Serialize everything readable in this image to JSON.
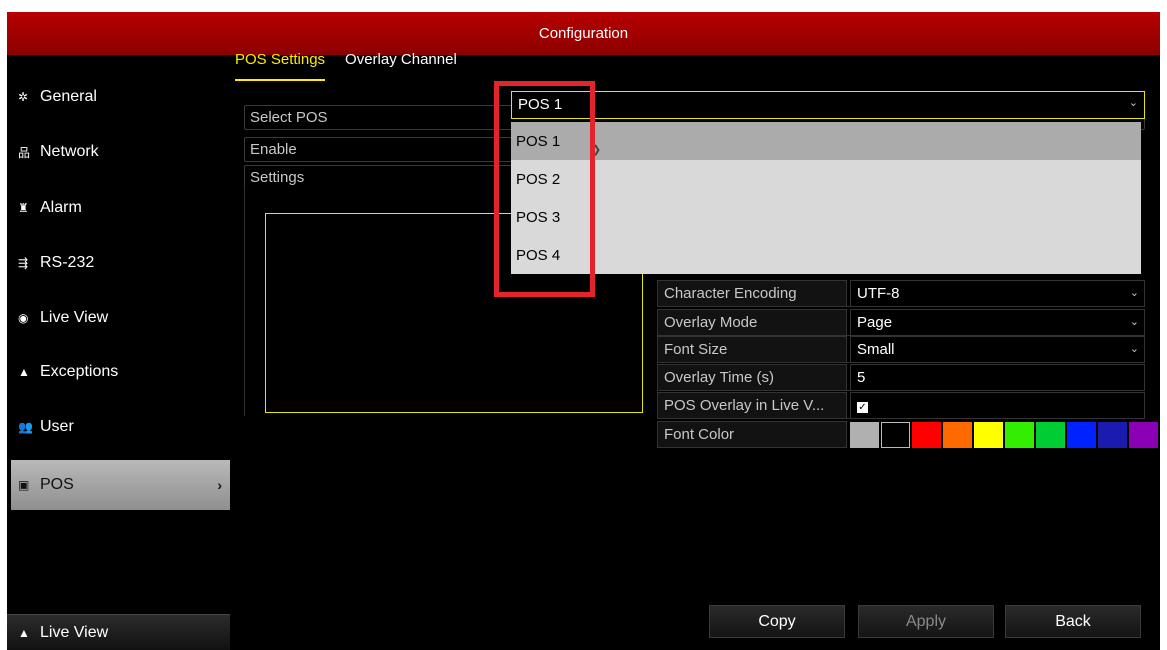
{
  "window": {
    "title": "Configuration"
  },
  "sidebar": {
    "items": [
      {
        "label": "General",
        "icon": "gear-icon",
        "glyph": "✲"
      },
      {
        "label": "Network",
        "icon": "network-icon",
        "glyph": "品"
      },
      {
        "label": "Alarm",
        "icon": "alarm-icon",
        "glyph": "♜"
      },
      {
        "label": "RS-232",
        "icon": "rs232-icon",
        "glyph": "⇶"
      },
      {
        "label": "Live View",
        "icon": "eye-icon",
        "glyph": "◉"
      },
      {
        "label": "Exceptions",
        "icon": "warning-icon",
        "glyph": "▲"
      },
      {
        "label": "User",
        "icon": "users-icon",
        "glyph": "👥"
      },
      {
        "label": "POS",
        "icon": "pos-icon",
        "glyph": "▣",
        "active": true,
        "arrow": "›"
      }
    ],
    "bottom": {
      "label": "Live View",
      "glyph": "▲"
    }
  },
  "tabs": [
    {
      "label": "POS Settings",
      "active": true
    },
    {
      "label": "Overlay Channel",
      "active": false
    }
  ],
  "form": {
    "select_pos_label": "Select POS",
    "select_pos_value": "POS 1",
    "enable_label": "Enable",
    "settings_label": "Settings",
    "chevron": "⌄"
  },
  "dropdown": {
    "options": [
      "POS 1",
      "POS 2",
      "POS 3",
      "POS 4"
    ],
    "hovered": "POS 1"
  },
  "settings_table": {
    "character_encoding": {
      "label": "Character Encoding",
      "value": "UTF-8"
    },
    "overlay_mode": {
      "label": "Overlay Mode",
      "value": "Page"
    },
    "font_size": {
      "label": "Font Size",
      "value": "Small"
    },
    "overlay_time": {
      "label": "Overlay Time (s)",
      "value": "5"
    },
    "pos_overlay_live_view": {
      "label": "POS Overlay in Live V...",
      "checked": true,
      "check_glyph": "✓"
    },
    "font_color": {
      "label": "Font Color",
      "colors": [
        "#b0b0b0",
        "#000000",
        "#ff0000",
        "#ff6a00",
        "#ffff00",
        "#33ee00",
        "#00cc33",
        "#0022ff",
        "#1b1bb0",
        "#8b00b5"
      ]
    }
  },
  "buttons": {
    "copy": "Copy",
    "apply": "Apply",
    "back": "Back"
  },
  "colors": {
    "title_bar": "#b80000",
    "active_tab": "#ffea00",
    "annotation_highlight": "#e3242b"
  }
}
